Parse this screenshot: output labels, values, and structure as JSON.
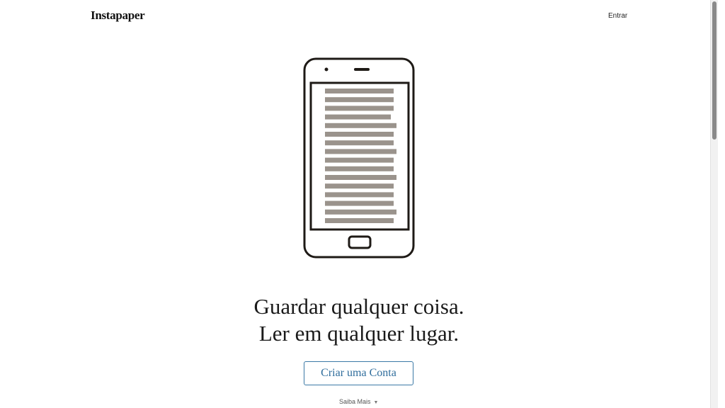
{
  "header": {
    "logo_text": "Instapaper",
    "login_label": "Entrar"
  },
  "hero": {
    "line1": "Guardar qualquer coisa.",
    "line2": "Ler em qualquer lugar.",
    "cta_label": "Criar uma Conta",
    "learn_more_label": "Saiba Mais",
    "learn_more_icon": "chevron-down-icon"
  },
  "illustration": {
    "icon": "phone-illustration",
    "frame_color": "#1e1a16",
    "text_line_color": "#9a938c"
  },
  "colors": {
    "accent": "#2f6d9c",
    "text": "#1a1a1a"
  }
}
